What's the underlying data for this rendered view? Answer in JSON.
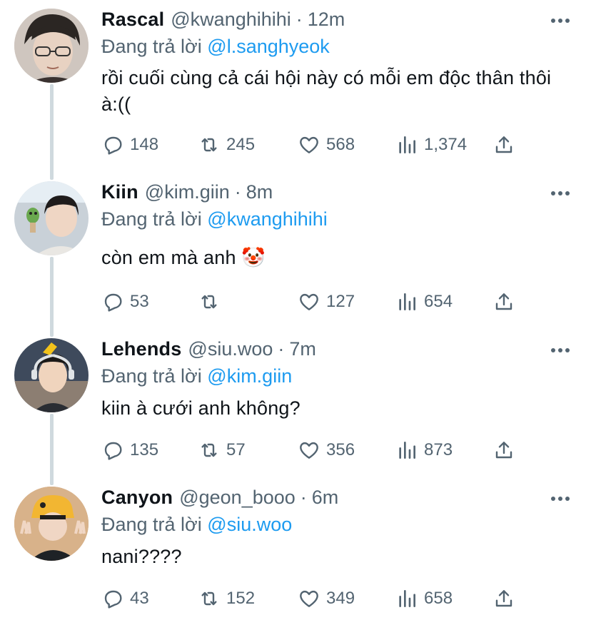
{
  "colors": {
    "text": "#0f1419",
    "muted": "#536471",
    "accent": "#1d9bf0",
    "thread_line": "#cfd9de"
  },
  "reply_prefix": "Đang trả lời",
  "tweets": [
    {
      "name": "Rascal",
      "handle": "@kwanghihihi",
      "dot": "·",
      "time": "12m",
      "reply_to": "@l.sanghyeok",
      "text": "rồi cuối cùng cả cái hội này có mỗi em độc thân thôi à:((",
      "replies": "148",
      "retweets": "245",
      "likes": "568",
      "views": "1,374"
    },
    {
      "name": "Kiin",
      "handle": "@kim.giin",
      "dot": "·",
      "time": "8m",
      "reply_to": "@kwanghihihi",
      "text": "còn em mà anh 🤡",
      "replies": "53",
      "retweets": "",
      "likes": "127",
      "views": "654"
    },
    {
      "name": "Lehends",
      "handle": "@siu.woo",
      "dot": "·",
      "time": "7m",
      "reply_to": "@kim.giin",
      "text": "kiin à cưới anh không?",
      "replies": "135",
      "retweets": "57",
      "likes": "356",
      "views": "873"
    },
    {
      "name": "Canyon",
      "handle": "@geon_booo",
      "dot": "·",
      "time": "6m",
      "reply_to": "@siu.woo",
      "text": "nani????",
      "replies": "43",
      "retweets": "152",
      "likes": "349",
      "views": "658"
    }
  ],
  "icons": {
    "reply": "reply-icon",
    "retweet": "retweet-icon",
    "like": "heart-icon",
    "views": "views-icon",
    "share": "share-icon",
    "more": "more-icon"
  }
}
